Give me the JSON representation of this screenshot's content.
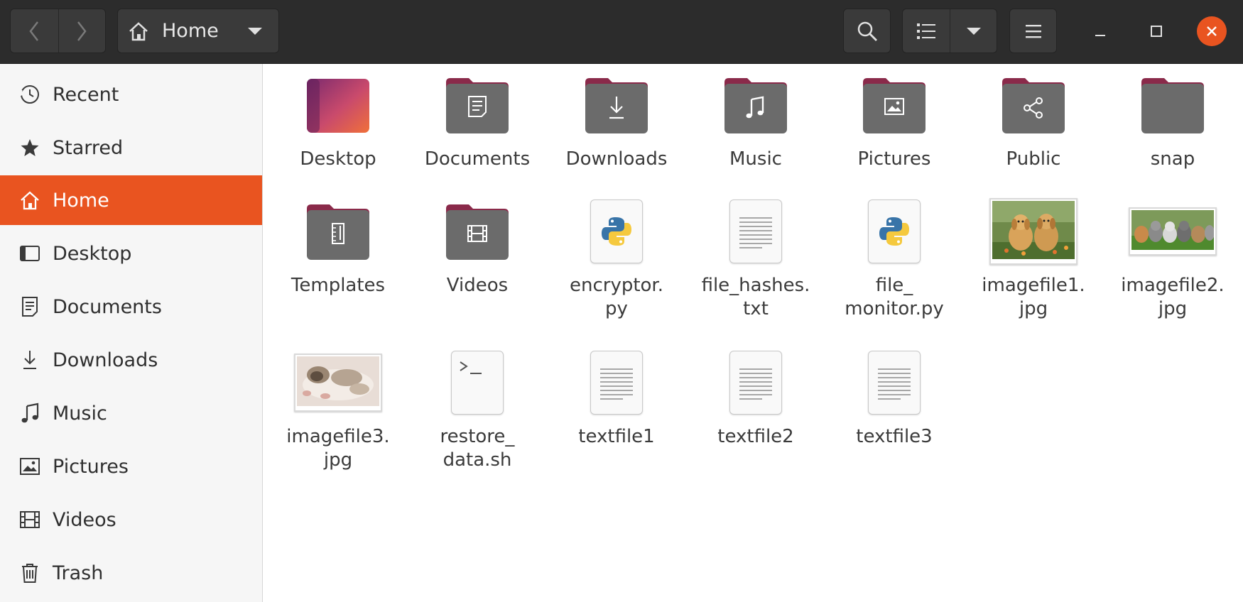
{
  "header": {
    "path_label": "Home",
    "back_icon": "chevron-left-icon",
    "forward_icon": "chevron-right-icon",
    "home_icon": "home-icon",
    "search_icon": "search-icon",
    "view_icon": "list-view-icon",
    "menu_icon": "hamburger-menu-icon",
    "accent": "#e95420"
  },
  "sidebar": {
    "items": [
      {
        "label": "Recent",
        "icon": "clock-icon",
        "active": false
      },
      {
        "label": "Starred",
        "icon": "star-icon",
        "active": false
      },
      {
        "label": "Home",
        "icon": "home-icon",
        "active": true
      },
      {
        "label": "Desktop",
        "icon": "desktop-icon",
        "active": false
      },
      {
        "label": "Documents",
        "icon": "document-icon",
        "active": false
      },
      {
        "label": "Downloads",
        "icon": "download-icon",
        "active": false
      },
      {
        "label": "Music",
        "icon": "music-icon",
        "active": false
      },
      {
        "label": "Pictures",
        "icon": "picture-icon",
        "active": false
      },
      {
        "label": "Videos",
        "icon": "film-icon",
        "active": false
      },
      {
        "label": "Trash",
        "icon": "trash-icon",
        "active": false
      }
    ]
  },
  "files": [
    {
      "name": "Desktop",
      "kind": "folder-desktop"
    },
    {
      "name": "Documents",
      "kind": "folder-documents"
    },
    {
      "name": "Downloads",
      "kind": "folder-downloads"
    },
    {
      "name": "Music",
      "kind": "folder-music"
    },
    {
      "name": "Pictures",
      "kind": "folder-pictures"
    },
    {
      "name": "Public",
      "kind": "folder-public"
    },
    {
      "name": "snap",
      "kind": "folder-plain"
    },
    {
      "name": "Templates",
      "kind": "folder-templates"
    },
    {
      "name": "Videos",
      "kind": "folder-videos"
    },
    {
      "name": "encryptor.\npy",
      "kind": "python"
    },
    {
      "name": "file_hashes.\ntxt",
      "kind": "text"
    },
    {
      "name": "file_\nmonitor.py",
      "kind": "python"
    },
    {
      "name": "imagefile1.\njpg",
      "kind": "image-dogs"
    },
    {
      "name": "imagefile2.\njpg",
      "kind": "image-cats-grass"
    },
    {
      "name": "imagefile3.\njpg",
      "kind": "image-cat"
    },
    {
      "name": "restore_\ndata.sh",
      "kind": "script"
    },
    {
      "name": "textfile1",
      "kind": "text"
    },
    {
      "name": "textfile2",
      "kind": "text"
    },
    {
      "name": "textfile3",
      "kind": "text"
    }
  ]
}
